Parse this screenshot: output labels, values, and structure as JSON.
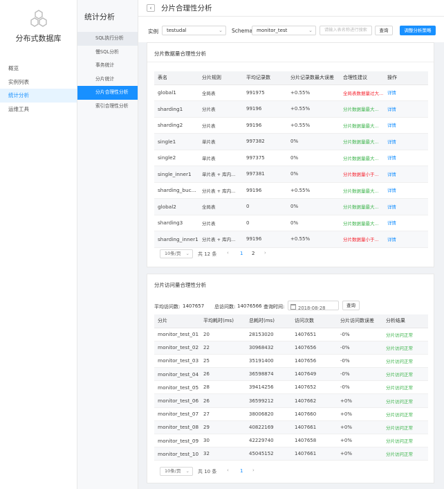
{
  "app": {
    "title": "分布式数据库"
  },
  "nav": [
    {
      "label": "概览"
    },
    {
      "label": "实例列表"
    },
    {
      "label": "统计分析"
    },
    {
      "label": "运维工具"
    }
  ],
  "subnav": {
    "title": "统计分析",
    "items": [
      {
        "label": "SQL执行分析"
      },
      {
        "label": "慢SQL分析"
      },
      {
        "label": "事务统计"
      },
      {
        "label": "分片统计"
      },
      {
        "label": "分片合理性分析"
      },
      {
        "label": "索引合理性分析"
      }
    ]
  },
  "header": {
    "back_icon": "chevron-left-icon",
    "title": "分片合理性分析"
  },
  "filters": {
    "instance_label": "实例",
    "instance_value": "testudal",
    "schema_label": "Schema",
    "schema_value": "monitor_test",
    "search_placeholder": "请输入表名称进行搜索",
    "query_label": "查询",
    "adjust_label": "调整分析策略"
  },
  "record_card": {
    "title": "分片数据量合理性分析",
    "columns": [
      "表名",
      "分片规则",
      "平均记录数",
      "分片记录数最大误差",
      "合理性建议",
      "操作"
    ],
    "rows": [
      {
        "name": "global1",
        "rule": "全局表",
        "avg": "991975",
        "err": "+0.55%",
        "advice": "全局表数据量过大...",
        "advice_status": "red",
        "action": "详情"
      },
      {
        "name": "sharding1",
        "rule": "分片表",
        "avg": "99196",
        "err": "+0.55%",
        "advice": "分片数据量最大...",
        "advice_status": "green",
        "action": "详情"
      },
      {
        "name": "sharding2",
        "rule": "分片表",
        "avg": "99196",
        "err": "+0.55%",
        "advice": "分片数据量最大...",
        "advice_status": "green",
        "action": "详情"
      },
      {
        "name": "single1",
        "rule": "单片表",
        "avg": "997382",
        "err": "0%",
        "advice": "分片数据量最大...",
        "advice_status": "green",
        "action": "详情"
      },
      {
        "name": "single2",
        "rule": "单片表",
        "avg": "997375",
        "err": "0%",
        "advice": "分片数据量最大...",
        "advice_status": "green",
        "action": "详情"
      },
      {
        "name": "single_inner1",
        "rule": "单片表 + 库内...",
        "avg": "997381",
        "err": "0%",
        "advice": "分片数据量小于...",
        "advice_status": "red",
        "action": "详情"
      },
      {
        "name": "sharding_buck...",
        "rule": "分片表 + 库内...",
        "avg": "99196",
        "err": "+0.55%",
        "advice": "分片数据量最大...",
        "advice_status": "green",
        "action": "详情"
      },
      {
        "name": "global2",
        "rule": "全局表",
        "avg": "0",
        "err": "0%",
        "advice": "分片数据量最大...",
        "advice_status": "green",
        "action": "详情"
      },
      {
        "name": "sharding3",
        "rule": "分片表",
        "avg": "0",
        "err": "0%",
        "advice": "分片数据量最大...",
        "advice_status": "green",
        "action": "详情"
      },
      {
        "name": "sharding_inner1",
        "rule": "分片表 + 库内...",
        "avg": "99196",
        "err": "+0.55%",
        "advice": "分片数据量小于...",
        "advice_status": "red",
        "action": "详情"
      }
    ],
    "pager": {
      "size_label": "10条/页",
      "total_label": "共 12 条",
      "pages": [
        "1",
        "2"
      ],
      "current": "1"
    }
  },
  "access_card": {
    "title": "分片访问量合理性分析",
    "avg_label": "平均访问数:",
    "avg_value": "1407657",
    "total_label": "总访问数:",
    "total_value": "14076566",
    "time_label": "查询时间:",
    "date_value": "2018-08-28",
    "query_label": "查询",
    "columns": [
      "分片",
      "平均耗时(ms)",
      "总耗时(ms)",
      "访问次数",
      "分片访问数误差",
      "分析结果"
    ],
    "rows": [
      {
        "shard": "monitor_test_01",
        "avg_ms": "20",
        "total_ms": "28153020",
        "visits": "1407651",
        "err": "-0%",
        "result": "分片访问正常"
      },
      {
        "shard": "monitor_test_02",
        "avg_ms": "22",
        "total_ms": "30968432",
        "visits": "1407656",
        "err": "-0%",
        "result": "分片访问正常"
      },
      {
        "shard": "monitor_test_03",
        "avg_ms": "25",
        "total_ms": "35191400",
        "visits": "1407656",
        "err": "-0%",
        "result": "分片访问正常"
      },
      {
        "shard": "monitor_test_04",
        "avg_ms": "26",
        "total_ms": "36598874",
        "visits": "1407649",
        "err": "-0%",
        "result": "分片访问正常"
      },
      {
        "shard": "monitor_test_05",
        "avg_ms": "28",
        "total_ms": "39414256",
        "visits": "1407652",
        "err": "-0%",
        "result": "分片访问正常"
      },
      {
        "shard": "monitor_test_06",
        "avg_ms": "26",
        "total_ms": "36599212",
        "visits": "1407662",
        "err": "+0%",
        "result": "分片访问正常"
      },
      {
        "shard": "monitor_test_07",
        "avg_ms": "27",
        "total_ms": "38006820",
        "visits": "1407660",
        "err": "+0%",
        "result": "分片访问正常"
      },
      {
        "shard": "monitor_test_08",
        "avg_ms": "29",
        "total_ms": "40822169",
        "visits": "1407661",
        "err": "+0%",
        "result": "分片访问正常"
      },
      {
        "shard": "monitor_test_09",
        "avg_ms": "30",
        "total_ms": "42229740",
        "visits": "1407658",
        "err": "+0%",
        "result": "分片访问正常"
      },
      {
        "shard": "monitor_test_10",
        "avg_ms": "32",
        "total_ms": "45045152",
        "visits": "1407661",
        "err": "+0%",
        "result": "分片访问正常"
      }
    ],
    "pager": {
      "size_label": "10条/页",
      "total_label": "共 10 条",
      "pages": [
        "1"
      ],
      "current": "1"
    }
  },
  "colors": {
    "accent": "#1890ff",
    "ok": "#3bb34a",
    "warn": "#f5222d"
  }
}
